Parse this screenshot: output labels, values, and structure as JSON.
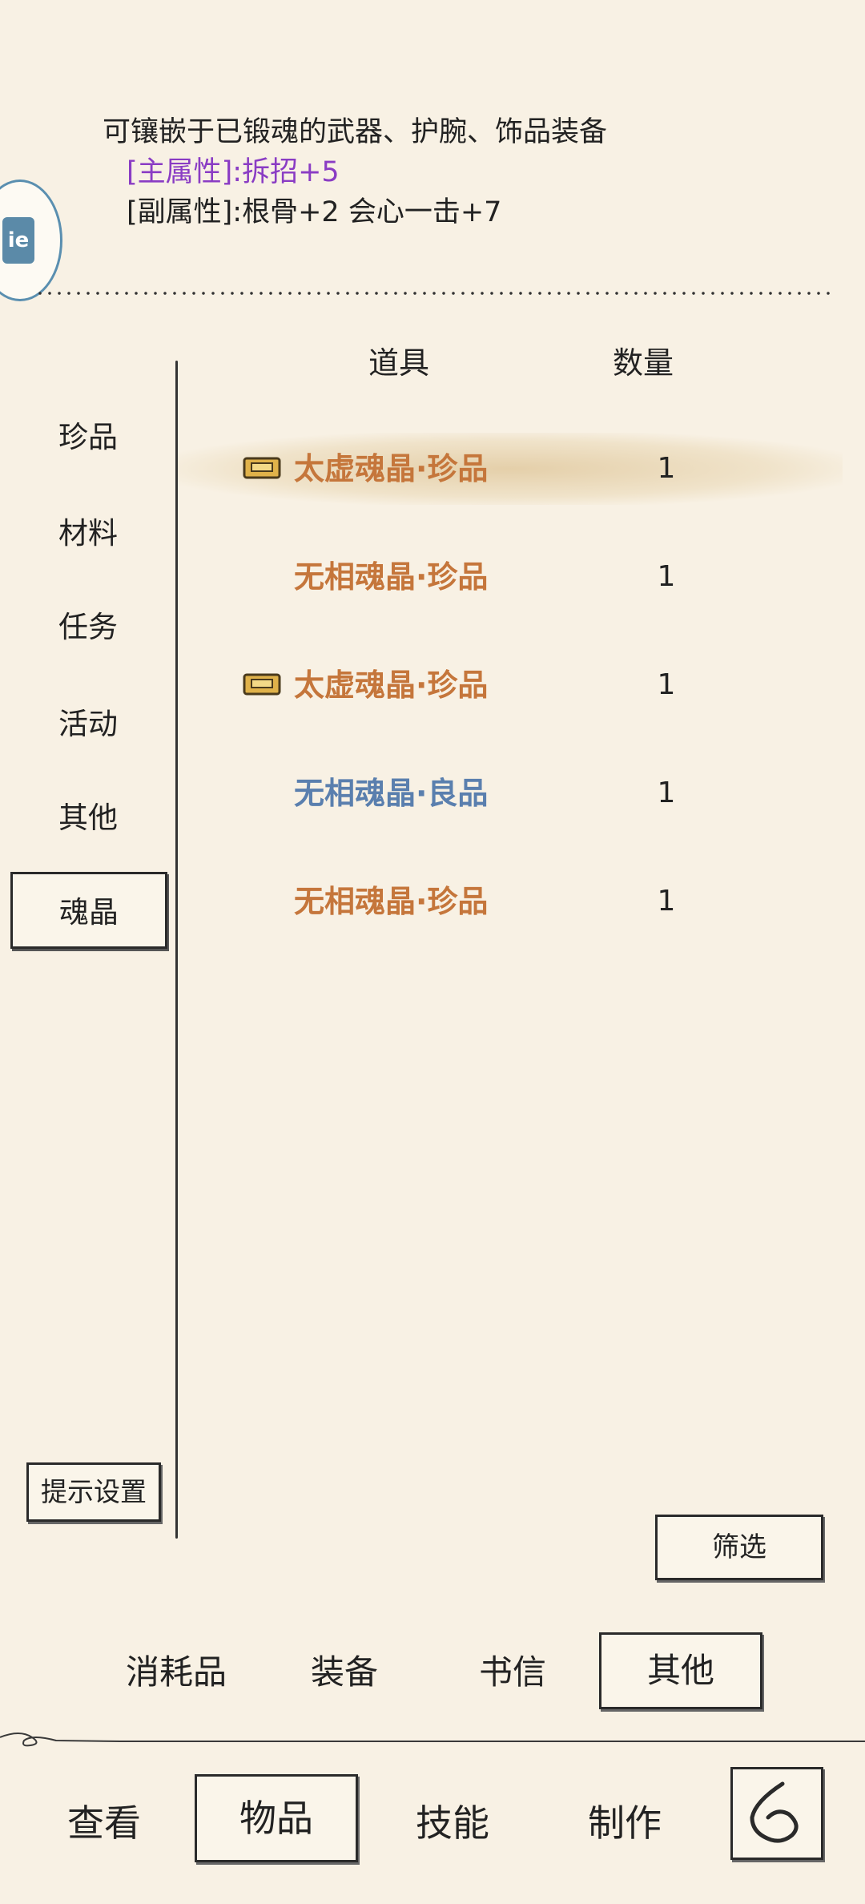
{
  "description": {
    "line1": "可镶嵌于已锻魂的武器、护腕、饰品装备",
    "main_attr": "[主属性]:拆招+5",
    "sub_attr": "[副属性]:根骨+2 会心一击+7"
  },
  "avatar": {
    "chip_text": "ie"
  },
  "table": {
    "header_item": "道具",
    "header_qty": "数量",
    "rows": [
      {
        "name": "太虚魂晶·珍品",
        "qty": "1",
        "color": "#c5763b",
        "locked": true,
        "selected": true
      },
      {
        "name": "无相魂晶·珍品",
        "qty": "1",
        "color": "#c5763b",
        "locked": false,
        "selected": false
      },
      {
        "name": "太虚魂晶·珍品",
        "qty": "1",
        "color": "#c5763b",
        "locked": true,
        "selected": false
      },
      {
        "name": "无相魂晶·良品",
        "qty": "1",
        "color": "#5a7fae",
        "locked": false,
        "selected": false
      },
      {
        "name": "无相魂晶·珍品",
        "qty": "1",
        "color": "#c5763b",
        "locked": false,
        "selected": false
      }
    ]
  },
  "categories": [
    "珍品",
    "材料",
    "任务",
    "活动",
    "其他",
    "魂晶"
  ],
  "selected_category": "魂晶",
  "hint_settings_label": "提示设置",
  "filter_label": "筛选",
  "sub_tabs": [
    "消耗品",
    "装备",
    "书信",
    "其他"
  ],
  "selected_sub_tab": "其他",
  "bottom_nav": [
    "查看",
    "物品",
    "技能",
    "制作"
  ],
  "selected_bottom_nav": "物品",
  "icons": {
    "lock": "lock-icon",
    "back": "back-arrow-icon"
  }
}
